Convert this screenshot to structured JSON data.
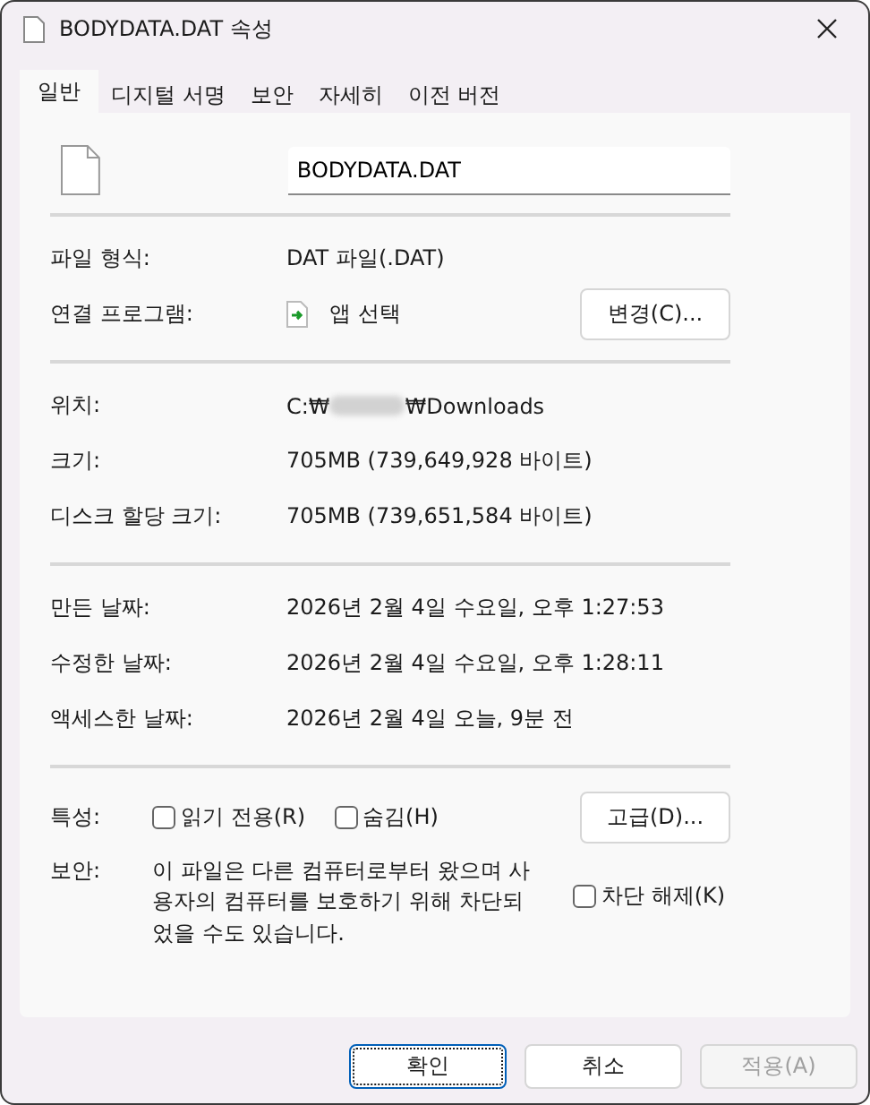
{
  "window": {
    "title": "BODYDATA.DAT 속성"
  },
  "tabs": [
    {
      "label": "일반",
      "selected": true
    },
    {
      "label": "디지털 서명",
      "selected": false
    },
    {
      "label": "보안",
      "selected": false
    },
    {
      "label": "자세히",
      "selected": false
    },
    {
      "label": "이전 버전",
      "selected": false
    }
  ],
  "file_name": {
    "value": "BODYDATA.DAT"
  },
  "file_type": {
    "label": "파일 형식:",
    "value": "DAT 파일(.DAT)"
  },
  "opens_with": {
    "label": "연결 프로그램:",
    "value": "앱 선택",
    "button": "변경(C)..."
  },
  "location": {
    "label": "위치:",
    "value_start": "C:₩",
    "value_end": "₩Downloads",
    "redacted": true
  },
  "size_rows": [
    {
      "label": "크기:",
      "value": "705MB (739,649,928 바이트)"
    },
    {
      "label": "디스크 할당 크기:",
      "value": "705MB (739,651,584 바이트)"
    }
  ],
  "date_rows": [
    {
      "label": "만든 날짜:",
      "value": "2026년 2월 4일 수요일, 오후 1:27:53"
    },
    {
      "label": "수정한 날짜:",
      "value": "2026년 2월 4일 수요일, 오후 1:28:11"
    },
    {
      "label": "액세스한 날짜:",
      "value": "2026년 2월 4일 오늘, 9분 전"
    }
  ],
  "attributes": {
    "label": "특성:",
    "options": [
      {
        "label": "읽기 전용(R)",
        "checked": false
      },
      {
        "label": "숨김(H)",
        "checked": false
      }
    ],
    "button": "고급(D)..."
  },
  "security": {
    "label": "보안:",
    "text": "이 파일은 다른 컴퓨터로부터 왔으며 사용자의 컴퓨터를 보호하기 위해 차단되었을 수도 있습니다.",
    "option": {
      "label": "차단 해제(K)",
      "checked": false
    }
  },
  "buttons": [
    {
      "label": "확인",
      "focused": true,
      "disabled": false
    },
    {
      "label": "취소",
      "focused": false,
      "disabled": false
    },
    {
      "label": "적용(A)",
      "focused": false,
      "disabled": true
    }
  ]
}
